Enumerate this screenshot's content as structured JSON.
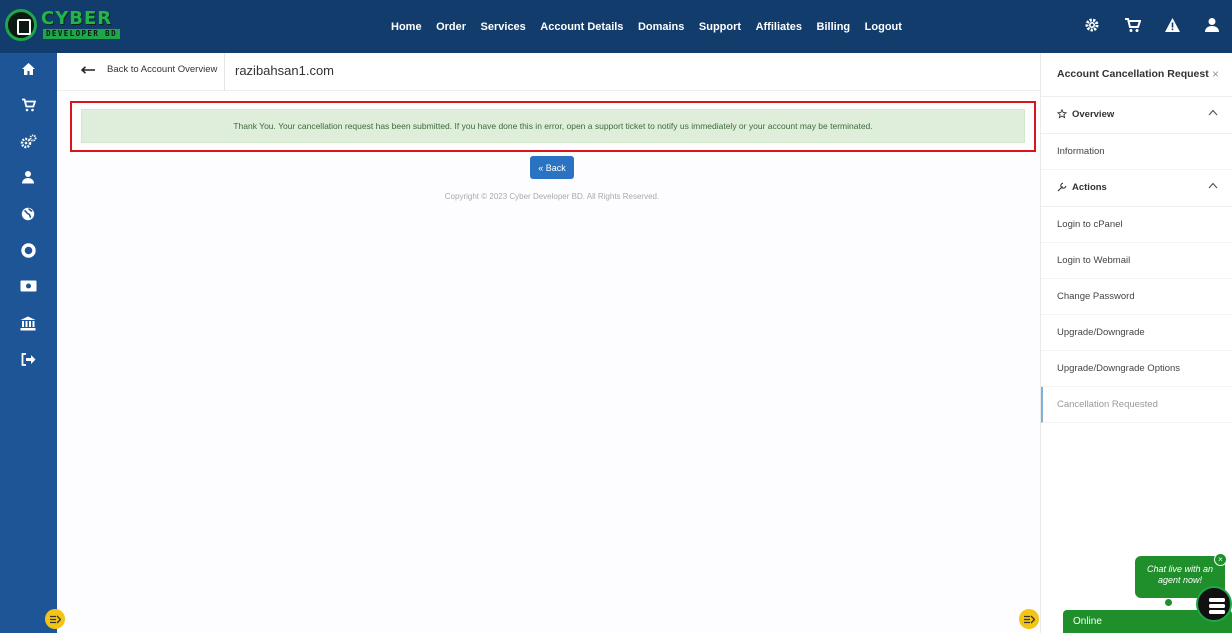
{
  "brand": {
    "name": "CYBER",
    "tagline": "DEVELOPER BD"
  },
  "nav": [
    {
      "label": "Home"
    },
    {
      "label": "Order"
    },
    {
      "label": "Services"
    },
    {
      "label": "Account Details"
    },
    {
      "label": "Domains"
    },
    {
      "label": "Support"
    },
    {
      "label": "Affiliates"
    },
    {
      "label": "Billing"
    },
    {
      "label": "Logout"
    }
  ],
  "top_icons": [
    "gear-icon",
    "cart-icon",
    "warning-icon",
    "user-icon"
  ],
  "sidebar_icons": [
    "home-icon",
    "cart-icon",
    "cogs-icon",
    "user-icon",
    "globe-icon",
    "lifebuoy-icon",
    "money-icon",
    "bank-icon",
    "sign-out-icon"
  ],
  "breadcrumb": {
    "back_label": "Back to Account Overview",
    "domain": "razibahsan1.com"
  },
  "alert": {
    "message": "Thank You. Your cancellation request has been submitted. If you have done this in error, open a support ticket to notify us immediately or your account may be terminated."
  },
  "back_button": {
    "label": "« Back"
  },
  "footer": {
    "copyright": "Copyright © 2023 Cyber Developer BD. All Rights Reserved."
  },
  "panel": {
    "title": "Account Cancellation Request",
    "close": "×",
    "overview": {
      "label": "Overview",
      "items": [
        {
          "label": "Information"
        }
      ]
    },
    "actions": {
      "label": "Actions",
      "items": [
        {
          "label": "Login to cPanel"
        },
        {
          "label": "Login to Webmail"
        },
        {
          "label": "Change Password"
        },
        {
          "label": "Upgrade/Downgrade"
        },
        {
          "label": "Upgrade/Downgrade Options"
        },
        {
          "label": "Cancellation Requested"
        }
      ]
    }
  },
  "chat": {
    "prompt": "Chat live with an agent now!",
    "status": "Online",
    "close": "×"
  },
  "colors": {
    "topbar": "#123c6b",
    "sidebar": "#1d5597",
    "alert_border": "#d81419",
    "alert_bg": "#dfeedb",
    "button": "#2a73c2",
    "chat": "#1f8f2c"
  }
}
